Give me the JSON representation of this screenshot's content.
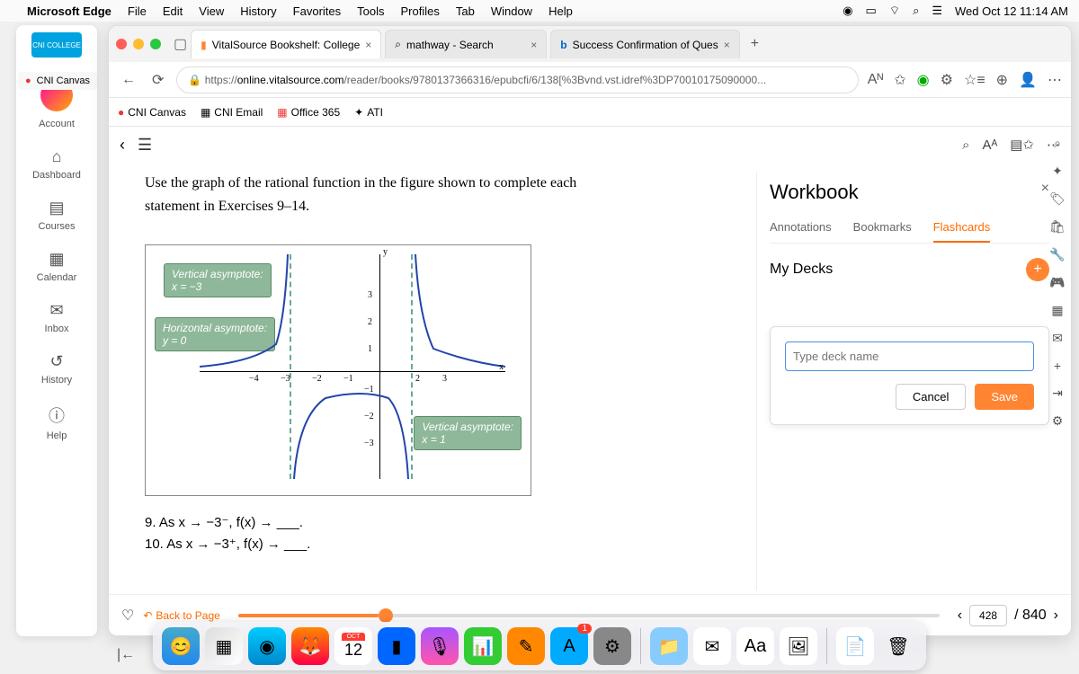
{
  "menubar": {
    "app": "Microsoft Edge",
    "items": [
      "File",
      "Edit",
      "View",
      "History",
      "Favorites",
      "Tools",
      "Profiles",
      "Tab",
      "Window",
      "Help"
    ],
    "datetime": "Wed Oct 12  11:14 AM"
  },
  "tabs": {
    "t1": "VitalSource Bookshelf: College",
    "t2": "mathway - Search",
    "t3": "Success Confirmation of Ques"
  },
  "url": {
    "prefix": "https://",
    "host": "online.vitalsource.com",
    "path": "/reader/books/9780137366316/epubcfi/6/138[%3Bvnd.vst.idref%3DP70010175090000..."
  },
  "bookmarks": {
    "b1": "CNI Canvas",
    "b2": "CNI Email",
    "b3": "Office 365",
    "b4": "ATI"
  },
  "canvas": {
    "logo": "CNI COLLEGE",
    "account": "Account",
    "dashboard": "Dashboard",
    "courses": "Courses",
    "calendar": "Calendar",
    "inbox": "Inbox",
    "history": "History",
    "help": "Help"
  },
  "cniCanvas": "CNI Canvas",
  "content": {
    "instruction": "Use the graph of the rational function in the figure shown to complete each statement in Exercises 9–14.",
    "va_label": "Vertical asymptote:",
    "va_eq1": "x = −3",
    "ha_label": "Horizontal asymptote:",
    "ha_eq": "y = 0",
    "va_eq2": "x = 1",
    "y": "y",
    "x": "x",
    "ex9": "9. As x → −3⁻,     f(x) → ___.",
    "ex10": "10. As x → −3⁺,    f(x) → ___."
  },
  "workbook": {
    "title": "Workbook",
    "tab1": "Annotations",
    "tab2": "Bookmarks",
    "tab3": "Flashcards",
    "decks": "My Decks",
    "placeholder": "Type deck name",
    "cancel": "Cancel",
    "save": "Save"
  },
  "footer": {
    "back": "Back to Page",
    "page": "428",
    "total": "/ 840"
  },
  "dock": {
    "cal_month": "OCT",
    "cal_day": "12",
    "badge": "1",
    "aa": "Aa"
  },
  "chart_data": {
    "type": "line",
    "title": "Rational function graph",
    "xlabel": "x",
    "ylabel": "y",
    "xlim": [
      -5,
      3
    ],
    "ylim": [
      -3,
      3
    ],
    "xticks": [
      -5,
      -4,
      -3,
      -2,
      -1,
      1,
      2,
      3
    ],
    "yticks": [
      -3,
      -2,
      -1,
      1,
      2,
      3
    ],
    "vertical_asymptotes": [
      -3,
      1
    ],
    "horizontal_asymptote": 0,
    "branches": [
      {
        "region": "x < -3",
        "samples": [
          [
            -5,
            0.1
          ],
          [
            -4.5,
            0.2
          ],
          [
            -4,
            0.5
          ],
          [
            -3.5,
            1.4
          ],
          [
            -3.2,
            3
          ]
        ]
      },
      {
        "region": "-3 < x < 1",
        "samples": [
          [
            -2.8,
            -3
          ],
          [
            -2.5,
            -1.2
          ],
          [
            -2,
            -0.6
          ],
          [
            -1,
            -0.3
          ],
          [
            0,
            -0.3
          ],
          [
            0.5,
            -0.7
          ],
          [
            0.8,
            -3
          ]
        ]
      },
      {
        "region": "x > 1",
        "samples": [
          [
            1.2,
            3
          ],
          [
            1.5,
            1.2
          ],
          [
            2,
            0.5
          ],
          [
            3,
            0.2
          ]
        ]
      }
    ]
  }
}
